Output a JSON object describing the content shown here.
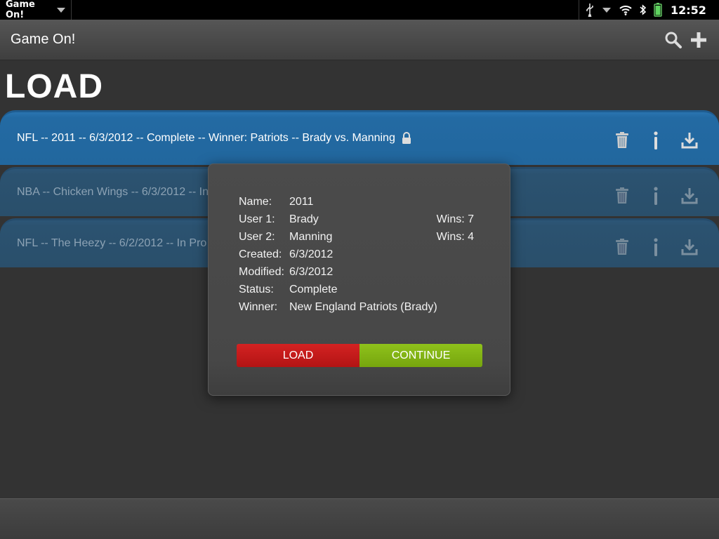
{
  "statusbar": {
    "app_title": "Game On!",
    "clock": "12:52",
    "icons": [
      "usb-icon",
      "chevron-down-icon",
      "wifi-icon",
      "bluetooth-icon",
      "battery-icon"
    ]
  },
  "appbar": {
    "title": "Game On!",
    "actions": [
      "search-icon",
      "plus-icon"
    ]
  },
  "page": {
    "heading": "LOAD"
  },
  "games": [
    {
      "label": "NFL -- 2011 -- 6/3/2012 -- Complete -- Winner: Patriots -- Brady vs. Manning",
      "locked": true
    },
    {
      "label": "NBA -- Chicken Wings -- 6/3/2012 -- In",
      "locked": false
    },
    {
      "label": "NFL -- The Heezy -- 6/2/2012 -- In Pro",
      "locked": false
    }
  ],
  "dialog": {
    "name_key": "Name:",
    "name_val": "2011",
    "user1_key": "User 1:",
    "user1_val": "Brady",
    "user1_wins": "Wins: 7",
    "user2_key": "User 2:",
    "user2_val": "Manning",
    "user2_wins": "Wins: 4",
    "created_key": "Created:",
    "created_val": "6/3/2012",
    "modified_key": "Modified:",
    "modified_val": "6/3/2012",
    "status_key": "Status:",
    "status_val": "Complete",
    "winner_key": "Winner:",
    "winner_val": "New England Patriots (Brady)",
    "load_label": "LOAD",
    "continue_label": "CONTINUE"
  },
  "colors": {
    "row_active": "#236aa3",
    "load_button": "#c41b1b",
    "continue_button": "#84b414"
  }
}
